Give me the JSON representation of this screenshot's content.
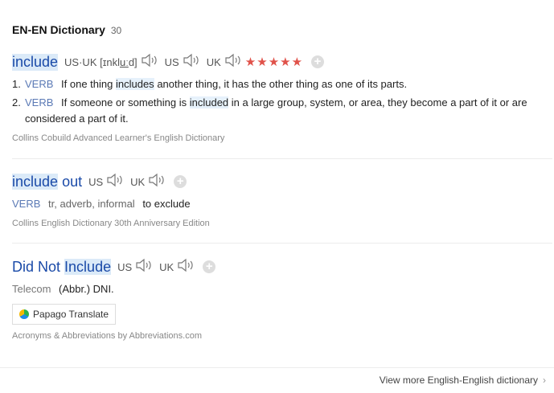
{
  "header": {
    "title": "EN-EN Dictionary",
    "count": "30"
  },
  "entries": [
    {
      "headword": "include",
      "pron": {
        "label": "US·UK",
        "ipa_pre": "[ɪnkl",
        "ipa_u": "uː",
        "ipa_post": "d]"
      },
      "us_label": "US",
      "uk_label": "UK",
      "stars": "★★★★★",
      "defs": [
        {
          "num": "1.",
          "pos": "VERB",
          "pre": "If one thing",
          "hl": "includes",
          "post": "another thing, it has the other thing as one of its parts."
        },
        {
          "num": "2.",
          "pos": "VERB",
          "pre": "If someone or something is",
          "hl": "included",
          "post": "in a large group, system, or area, they become a part of it or are considered a part of it."
        }
      ],
      "source": "Collins Cobuild Advanced Learner's English Dictionary"
    },
    {
      "headword_hl": "include",
      "headword_rest": "out",
      "us_label": "US",
      "uk_label": "UK",
      "pos": "VERB",
      "tags": "tr, adverb, informal",
      "meaning": "to exclude",
      "source": "Collins English Dictionary 30th Anniversary Edition"
    },
    {
      "headword_pre": "Did Not",
      "headword_hl": "Include",
      "us_label": "US",
      "uk_label": "UK",
      "pos": "Telecom",
      "meaning": "(Abbr.) DNI.",
      "papago": "Papago Translate",
      "source": "Acronyms & Abbreviations by Abbreviations.com"
    }
  ],
  "footer": {
    "more": "View more English-English dictionary"
  },
  "colors": {
    "headword": "#1a4aa8",
    "pos": "#5a79b5",
    "stars": "#e0524a"
  },
  "icons": [
    "speaker-icon",
    "plus-icon",
    "chevron-right-icon",
    "papago-logo-icon"
  ]
}
